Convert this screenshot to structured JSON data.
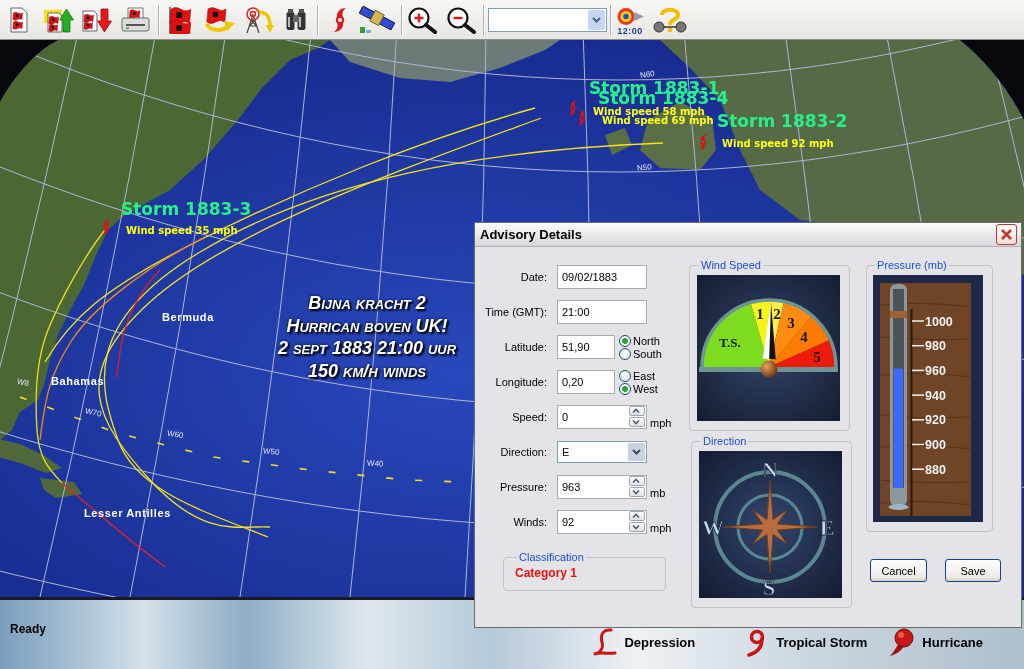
{
  "toolbar": {
    "clock_label": "12:00"
  },
  "map": {
    "storms": [
      {
        "name": "Storm 1883-1",
        "wind": "Wind speed 58 mph"
      },
      {
        "name": "Storm 1883-4",
        "wind": "Wind speed 69 mph"
      },
      {
        "name": "Storm 1883-2",
        "wind": "Wind speed 92 mph"
      },
      {
        "name": "Storm 1883-3",
        "wind": "Wind speed 35 mph"
      }
    ],
    "grid_labels": [
      "N60",
      "N50",
      "W8",
      "W70",
      "W60",
      "W50",
      "W40"
    ],
    "places": [
      "Bermuda",
      "Bahamas",
      "Lesser Antilles"
    ],
    "headline": [
      "Bijna kracht 2",
      "Hurrican boven UK!",
      "2 sept 1883 21:00 uur",
      "150 km/h winds"
    ]
  },
  "dialog": {
    "title": "Advisory Details",
    "fields": [
      {
        "kind": "text",
        "label": "Date:",
        "value": "09/02/1883"
      },
      {
        "kind": "text",
        "label": "Time (GMT):",
        "value": "21:00"
      },
      {
        "kind": "radio",
        "label": "Latitude:",
        "value": "51,90",
        "options": [
          {
            "label": "North",
            "selected": true
          },
          {
            "label": "South",
            "selected": false
          }
        ]
      },
      {
        "kind": "radio",
        "label": "Longitude:",
        "value": "0,20",
        "options": [
          {
            "label": "East",
            "selected": false
          },
          {
            "label": "West",
            "selected": true
          }
        ]
      },
      {
        "kind": "spin",
        "label": "Speed:",
        "value": "0",
        "unit": "mph"
      },
      {
        "kind": "select",
        "label": "Direction:",
        "value": "E"
      },
      {
        "kind": "spin",
        "label": "Pressure:",
        "value": "963",
        "unit": "mb"
      },
      {
        "kind": "spin",
        "label": "Winds:",
        "value": "92",
        "unit": "mph"
      }
    ],
    "classification": {
      "title": "Classification",
      "value": "Category 1"
    },
    "wind_speed": {
      "title": "Wind Speed",
      "level": 0.51,
      "zones": [
        {
          "label": "T.S.",
          "color": "#7ddc1e"
        },
        {
          "label": "1",
          "color": "#f5f51a"
        },
        {
          "label": "2",
          "color": "#fff04a"
        },
        {
          "label": "3",
          "color": "#ff8c10"
        },
        {
          "label": "4",
          "color": "#ff7a00"
        },
        {
          "label": "5",
          "color": "#ee1a0a"
        }
      ]
    },
    "direction": {
      "title": "Direction",
      "points": [
        "N",
        "E",
        "S",
        "W"
      ]
    },
    "pressure": {
      "title": "Pressure (mb)",
      "level": 0.6,
      "ticks": [
        "1000",
        "980",
        "960",
        "940",
        "920",
        "900",
        "880"
      ]
    },
    "buttons": [
      "Cancel",
      "Save"
    ]
  },
  "status_bar": {
    "text": "Ready",
    "legend": [
      {
        "kind": "depression",
        "label": "Depression"
      },
      {
        "kind": "tropical_storm",
        "label": "Tropical Storm"
      },
      {
        "kind": "hurricane",
        "label": "Hurricane"
      }
    ]
  }
}
